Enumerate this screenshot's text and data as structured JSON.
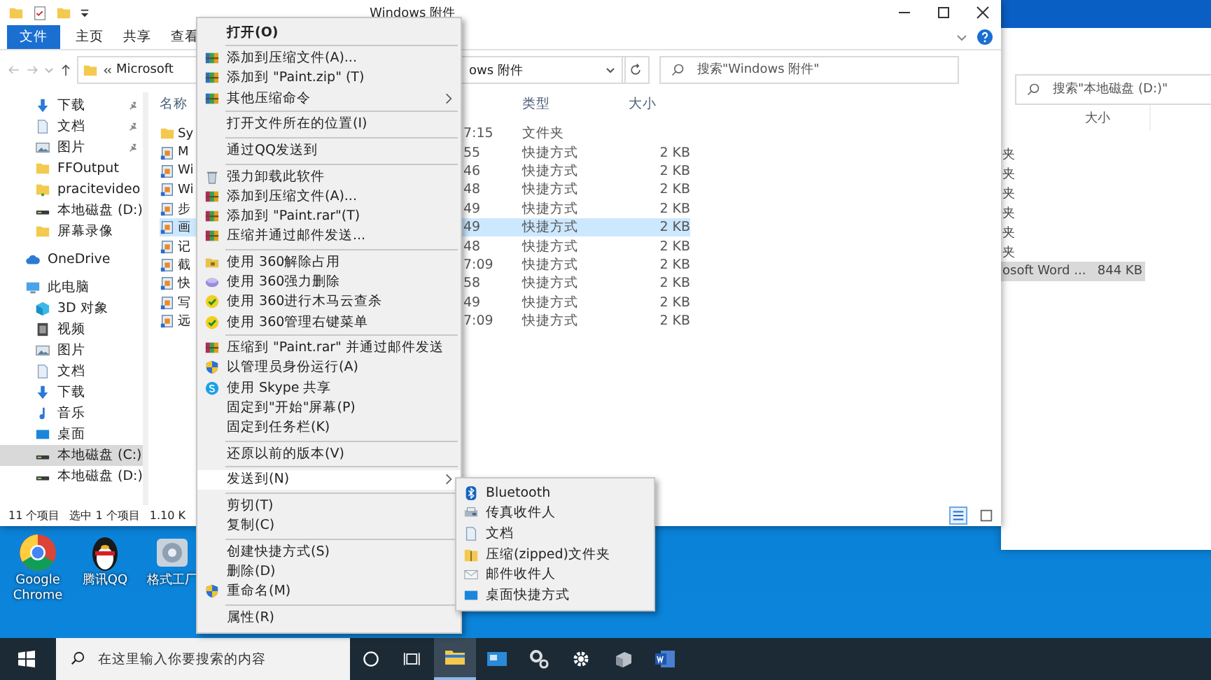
{
  "window": {
    "title": "Windows 附件"
  },
  "ribbon_tabs": [
    {
      "label": "文件",
      "selected": true
    },
    {
      "label": "主页",
      "selected": false
    },
    {
      "label": "共享",
      "selected": false
    },
    {
      "label": "查看",
      "selected": false
    }
  ],
  "address_bar": {
    "path_start": "Microsoft",
    "path_end": "ows 附件"
  },
  "search": {
    "placeholder": "搜索\"Windows 附件\""
  },
  "sidebar": {
    "quick_access": [
      {
        "kind": "download",
        "label": "下载",
        "pinned": true,
        "selected": false
      },
      {
        "kind": "document",
        "label": "文档",
        "pinned": true,
        "selected": false
      },
      {
        "kind": "picture",
        "label": "图片",
        "pinned": true,
        "selected": false
      },
      {
        "kind": "folder",
        "label": "FFOutput",
        "pinned": false,
        "selected": false
      },
      {
        "kind": "video-folder",
        "label": "pracitevideo",
        "pinned": false,
        "selected": false
      },
      {
        "kind": "drive",
        "label": "本地磁盘 (D:)",
        "pinned": false,
        "selected": false
      },
      {
        "kind": "folder",
        "label": "屏幕录像",
        "pinned": false,
        "selected": false
      }
    ],
    "nodes": [
      {
        "kind": "cloud",
        "label": "OneDrive",
        "selected": false
      },
      {
        "kind": "computer",
        "label": "此电脑",
        "selected": false,
        "children": [
          {
            "kind": "cube",
            "label": "3D 对象",
            "selected": false
          },
          {
            "kind": "video",
            "label": "视频",
            "selected": false
          },
          {
            "kind": "picture",
            "label": "图片",
            "selected": false
          },
          {
            "kind": "document",
            "label": "文档",
            "selected": false
          },
          {
            "kind": "download",
            "label": "下载",
            "selected": false
          },
          {
            "kind": "music",
            "label": "音乐",
            "selected": false
          },
          {
            "kind": "desktop",
            "label": "桌面",
            "selected": false
          },
          {
            "kind": "drive",
            "label": "本地磁盘 (C:)",
            "selected": true
          },
          {
            "kind": "drive",
            "label": "本地磁盘 (D:)",
            "selected": false
          }
        ]
      }
    ]
  },
  "file_list": {
    "columns": {
      "name": "名称",
      "type": "类型",
      "size": "大小"
    },
    "rows": [
      {
        "kind": "folder",
        "name": "Sy",
        "modified": "7:15",
        "type": "文件夹",
        "selected": false
      },
      {
        "kind": "shortcut",
        "name": "M",
        "modified": "55",
        "type": "快捷方式",
        "size": "2 KB",
        "selected": false
      },
      {
        "kind": "shortcut",
        "name": "Wi",
        "modified": "46",
        "type": "快捷方式",
        "size": "2 KB",
        "selected": false
      },
      {
        "kind": "shortcut",
        "name": "Wi",
        "modified": "48",
        "type": "快捷方式",
        "size": "2 KB",
        "selected": false
      },
      {
        "kind": "shortcut",
        "name": "步",
        "modified": "49",
        "type": "快捷方式",
        "size": "2 KB",
        "selected": false
      },
      {
        "kind": "shortcut",
        "name": "画",
        "modified": "49",
        "type": "快捷方式",
        "size": "2 KB",
        "selected": true
      },
      {
        "kind": "shortcut",
        "name": "记",
        "modified": "48",
        "type": "快捷方式",
        "size": "2 KB",
        "selected": false
      },
      {
        "kind": "shortcut",
        "name": "截",
        "modified": "7:09",
        "type": "快捷方式",
        "size": "2 KB",
        "selected": false
      },
      {
        "kind": "shortcut",
        "name": "快",
        "modified": "58",
        "type": "快捷方式",
        "size": "2 KB",
        "selected": false
      },
      {
        "kind": "shortcut",
        "name": "写",
        "modified": "49",
        "type": "快捷方式",
        "size": "2 KB",
        "selected": false
      },
      {
        "kind": "shortcut",
        "name": "远",
        "modified": "7:09",
        "type": "快捷方式",
        "size": "2 KB",
        "selected": false
      }
    ]
  },
  "status_bar": {
    "count": "11 个项目",
    "selection": "选中 1 个项目",
    "size": "1.10 K"
  },
  "context_menu": [
    {
      "kind": "plain",
      "label": "打开(O)",
      "default": true
    },
    {
      "kind": "separator"
    },
    {
      "kind": "archive",
      "label": "添加到压缩文件(A)...",
      "default": false
    },
    {
      "kind": "archive",
      "label": "添加到 \"Paint.zip\" (T)",
      "default": false
    },
    {
      "kind": "archive",
      "label": "其他压缩命令",
      "default": false,
      "submenu": true
    },
    {
      "kind": "separator"
    },
    {
      "kind": "plain",
      "label": "打开文件所在的位置(I)",
      "default": false
    },
    {
      "kind": "separator"
    },
    {
      "kind": "plain",
      "label": "通过QQ发送到",
      "default": false
    },
    {
      "kind": "separator"
    },
    {
      "kind": "trash",
      "label": "强力卸载此软件",
      "default": false
    },
    {
      "kind": "rar",
      "label": "添加到压缩文件(A)...",
      "default": false
    },
    {
      "kind": "rar",
      "label": "添加到 \"Paint.rar\"(T)",
      "default": false
    },
    {
      "kind": "rar",
      "label": "压缩并通过邮件发送...",
      "default": false
    },
    {
      "kind": "separator"
    },
    {
      "kind": "unlock",
      "label": "使用 360解除占用",
      "default": false
    },
    {
      "kind": "eraser",
      "label": "使用 360强力删除",
      "default": false
    },
    {
      "kind": "scan",
      "label": "使用 360进行木马云查杀",
      "default": false
    },
    {
      "kind": "scan",
      "label": "使用 360管理右键菜单",
      "default": false
    },
    {
      "kind": "separator"
    },
    {
      "kind": "rar",
      "label": "压缩到 \"Paint.rar\" 并通过邮件发送",
      "default": false
    },
    {
      "kind": "shield",
      "label": "以管理员身份运行(A)",
      "default": false
    },
    {
      "kind": "skype",
      "label": "使用 Skype 共享",
      "default": false
    },
    {
      "kind": "plain",
      "label": "固定到\"开始\"屏幕(P)",
      "default": false
    },
    {
      "kind": "plain",
      "label": "固定到任务栏(K)",
      "default": false
    },
    {
      "kind": "separator"
    },
    {
      "kind": "plain",
      "label": "还原以前的版本(V)",
      "default": false
    },
    {
      "kind": "separator"
    },
    {
      "kind": "plain",
      "label": "发送到(N)",
      "default": false,
      "submenu": true,
      "selected": true
    },
    {
      "kind": "separator"
    },
    {
      "kind": "plain",
      "label": "剪切(T)",
      "default": false
    },
    {
      "kind": "plain",
      "label": "复制(C)",
      "default": false
    },
    {
      "kind": "separator"
    },
    {
      "kind": "plain",
      "label": "创建快捷方式(S)",
      "default": false
    },
    {
      "kind": "plain",
      "label": "删除(D)",
      "default": false
    },
    {
      "kind": "shield",
      "label": "重命名(M)",
      "default": false
    },
    {
      "kind": "separator"
    },
    {
      "kind": "plain",
      "label": "属性(R)",
      "default": false
    }
  ],
  "send_to_menu": [
    {
      "kind": "bluetooth",
      "label": "Bluetooth"
    },
    {
      "kind": "fax",
      "label": "传真收件人"
    },
    {
      "kind": "document",
      "label": "文档"
    },
    {
      "kind": "zip",
      "label": "压缩(zipped)文件夹"
    },
    {
      "kind": "mail",
      "label": "邮件收件人"
    },
    {
      "kind": "desktop",
      "label": "桌面快捷方式"
    }
  ],
  "back_window": {
    "search": {
      "placeholder": "搜索\"本地磁盘 (D:)\""
    },
    "size_column": "大小",
    "rows": [
      {
        "type": "夹",
        "selected": false
      },
      {
        "type": "夹",
        "selected": false
      },
      {
        "type": "夹",
        "selected": false
      },
      {
        "type": "夹",
        "selected": false
      },
      {
        "type": "夹",
        "selected": false
      },
      {
        "type": "夹",
        "selected": false
      },
      {
        "type": "osoft Word ...",
        "size": "844 KB",
        "selected": true
      }
    ]
  },
  "desktop_icons": [
    {
      "kind": "browser",
      "label": "Google Chrome"
    },
    {
      "kind": "penguin",
      "label": "腾讯QQ"
    },
    {
      "kind": "converter",
      "label": "格式工厂"
    }
  ],
  "taskbar": {
    "search_placeholder": "在这里输入你要搜索的内容",
    "apps": [
      {
        "kind": "explorer",
        "active": true
      },
      {
        "kind": "window",
        "active": false
      },
      {
        "kind": "gears",
        "active": false
      },
      {
        "kind": "settings",
        "active": false
      },
      {
        "kind": "box",
        "active": false
      },
      {
        "kind": "word",
        "active": false
      }
    ]
  }
}
